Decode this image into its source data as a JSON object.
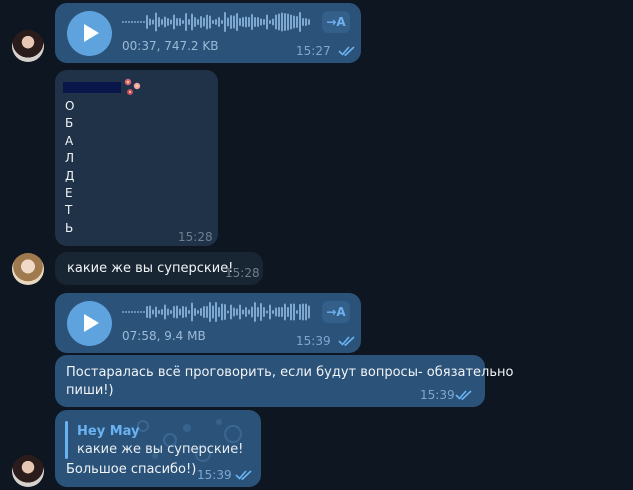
{
  "messages": {
    "voice1": {
      "meta": "00:37, 747.2 KB",
      "time": "15:27",
      "translate": "→A"
    },
    "letters": {
      "chars": [
        "О",
        "Б",
        "А",
        "Л",
        "Д",
        "Е",
        "Т",
        "Ь"
      ],
      "time": "15:28"
    },
    "text1": {
      "text": "какие же вы суперские!",
      "time": "15:28"
    },
    "voice2": {
      "meta": "07:58, 9.4 MB",
      "time": "15:39",
      "translate": "→A"
    },
    "text2": {
      "line1": "Постаралась всё проговорить, если будут вопросы- обязательно",
      "line2": "пиши!)",
      "time": "15:39"
    },
    "reply": {
      "quoted_name": "Hey May",
      "quoted_text": "какие же вы суперские!",
      "text": "Большое спасибо!)",
      "time": "15:39"
    }
  },
  "icons": {
    "play": "play-icon",
    "read": "double-check-icon",
    "flowers": "flower-sticker-icon"
  },
  "colors": {
    "background": "#0e1621",
    "outgoing_bubble": "#2b5278",
    "incoming_bubble": "#182533",
    "accent": "#5fa3de",
    "reply_accent": "#6ab3f3"
  }
}
